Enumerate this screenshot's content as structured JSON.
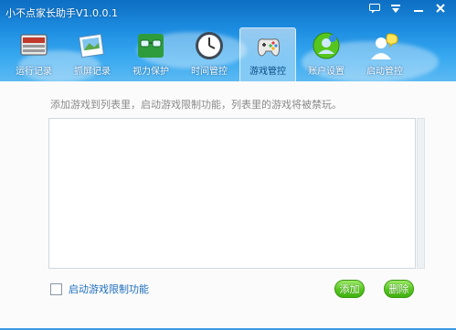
{
  "window": {
    "title": "小不点家长助手V1.0.0.1"
  },
  "titlebar_controls": [
    {
      "icon": "chat-icon"
    },
    {
      "icon": "menu-arrow-icon"
    },
    {
      "icon": "minimize-icon"
    },
    {
      "icon": "close-icon"
    }
  ],
  "toolbar": {
    "items": [
      {
        "label": "运行记录",
        "icon": "monitor-icon"
      },
      {
        "label": "抓屏记录",
        "icon": "screenshot-icon"
      },
      {
        "label": "视力保护",
        "icon": "eye-protection-icon"
      },
      {
        "label": "时间管控",
        "icon": "clock-icon"
      },
      {
        "label": "游戏管控",
        "icon": "gamepad-icon"
      },
      {
        "label": "账户设置",
        "icon": "account-settings-icon"
      },
      {
        "label": "启动管控",
        "icon": "startup-control-icon"
      }
    ],
    "active_index": 4
  },
  "main": {
    "hint": "添加游戏到列表里，启动游戏限制功能，列表里的游戏将被禁玩。",
    "checkbox_label": "启动游戏限制功能",
    "checkbox_checked": false,
    "add_button": "添加",
    "delete_button": "删除"
  },
  "colors": {
    "header_top": "#0d6ec2",
    "header_bottom": "#5cbaf2",
    "button_green": "#56c61e",
    "link_blue": "#1f6fbe"
  }
}
